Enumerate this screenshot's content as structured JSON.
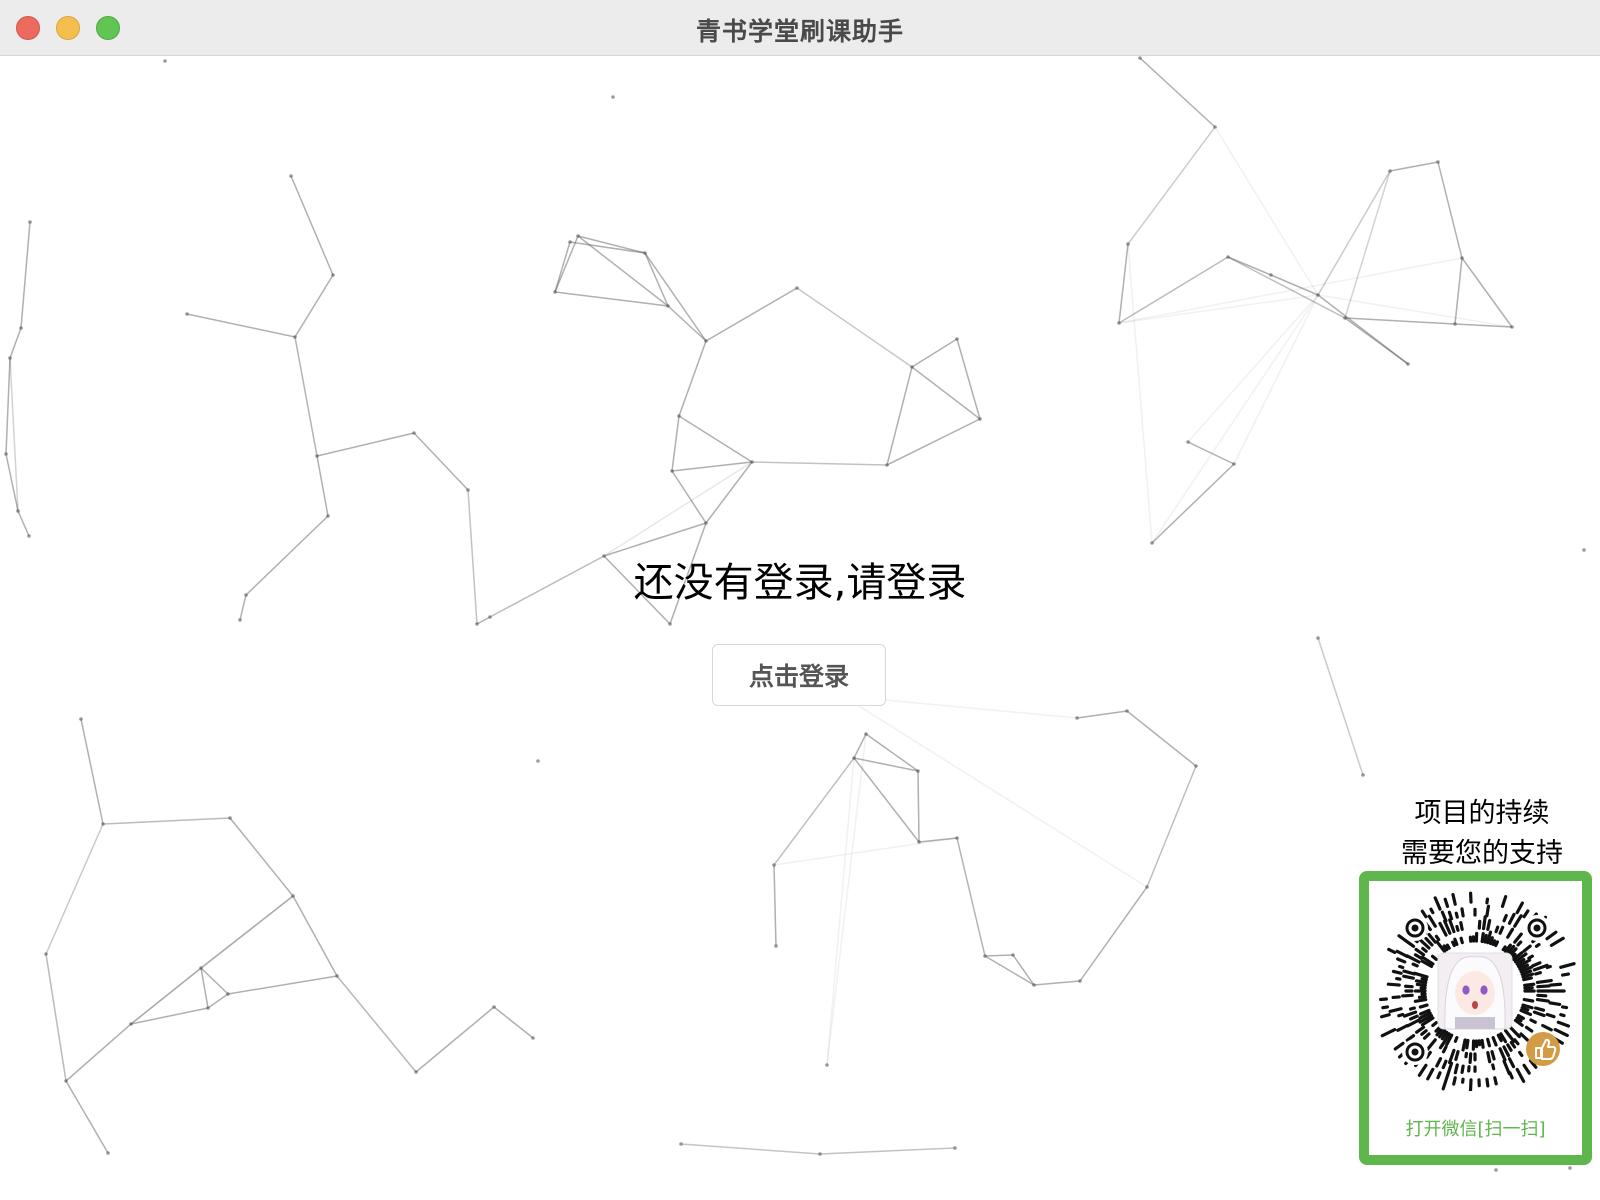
{
  "window": {
    "title": "青书学堂刷课助手"
  },
  "main": {
    "prompt": "还没有登录,请登录",
    "login_button": "点击登录"
  },
  "support": {
    "line1": "项目的持续",
    "line2": "需要您的支持",
    "qr_caption": "打开微信[扫一扫]"
  },
  "colors": {
    "accent_green": "#5fb64d",
    "close": "#ed6a5e",
    "minimize": "#f5bf4f",
    "maximize": "#61c554"
  }
}
